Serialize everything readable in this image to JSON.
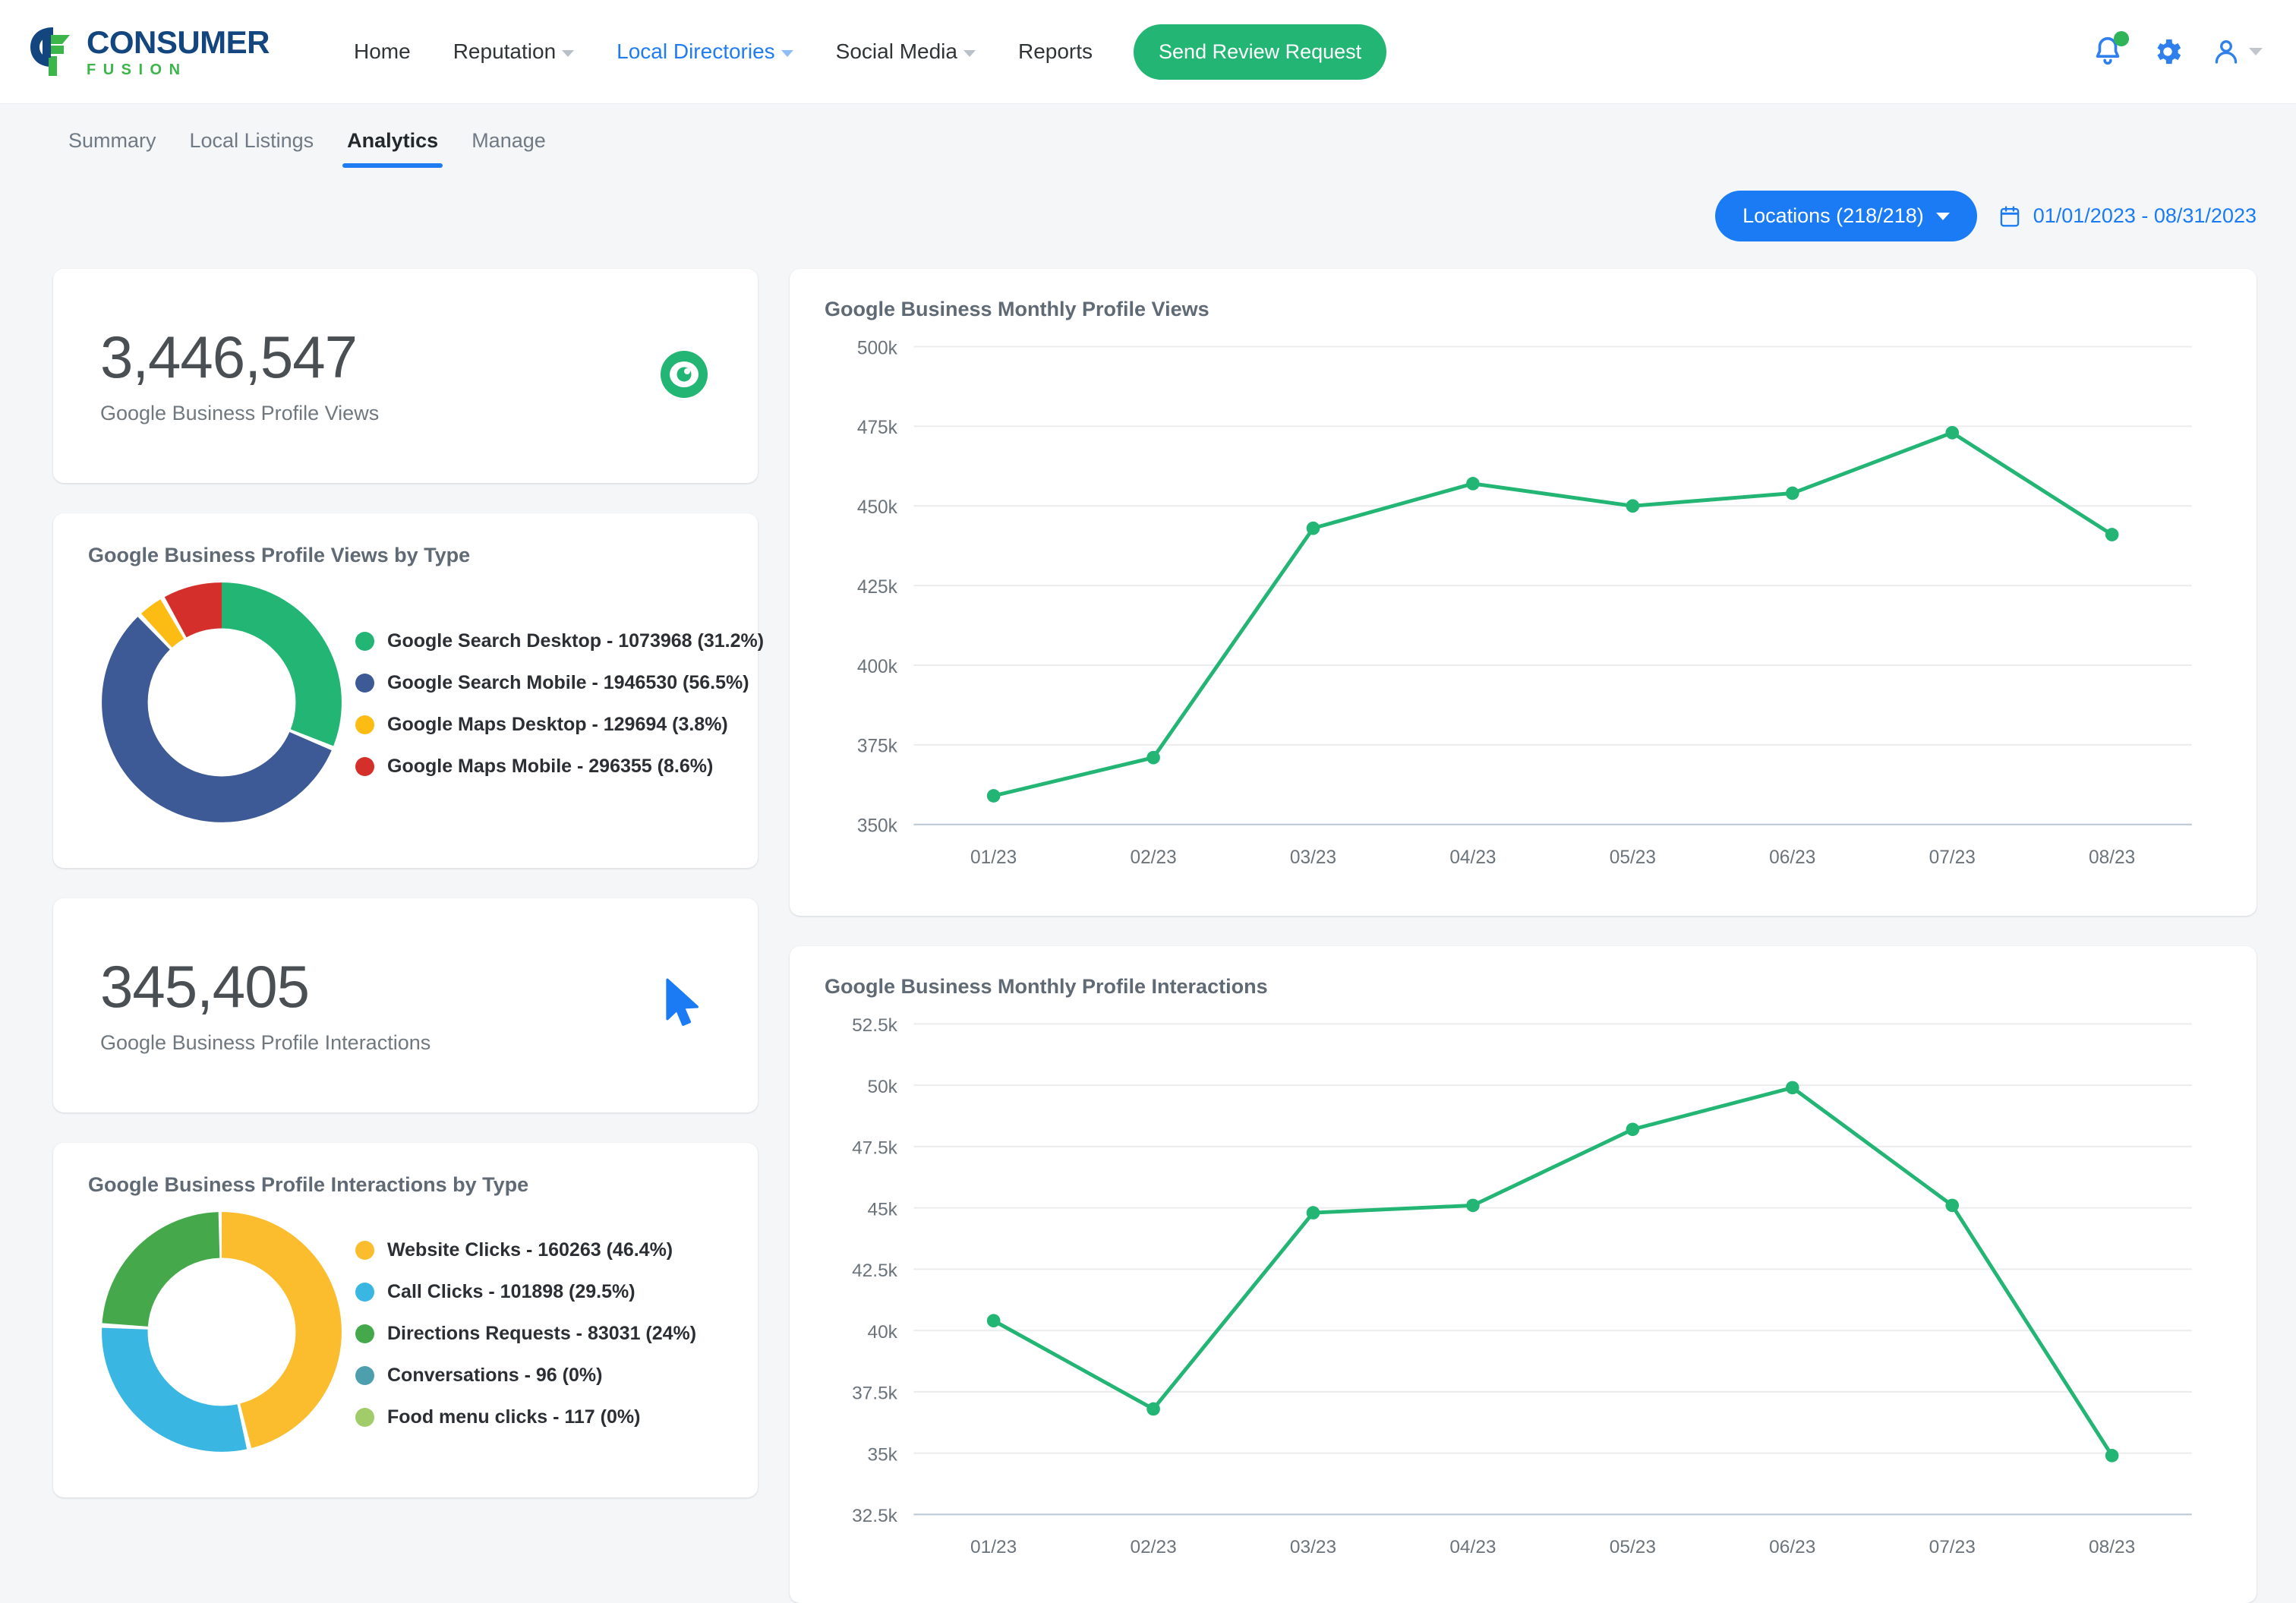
{
  "brand": {
    "name_top": "CONSUMER",
    "name_bottom": "FUSION"
  },
  "nav": {
    "items": [
      {
        "label": "Home",
        "has_caret": false,
        "active": false
      },
      {
        "label": "Reputation",
        "has_caret": true,
        "active": false
      },
      {
        "label": "Local Directories",
        "has_caret": true,
        "active": true
      },
      {
        "label": "Social Media",
        "has_caret": true,
        "active": false
      },
      {
        "label": "Reports",
        "has_caret": false,
        "active": false
      }
    ],
    "cta_label": "Send Review Request",
    "icons": [
      "notification-bell-icon",
      "gear-icon",
      "user-avatar-icon"
    ]
  },
  "subtabs": [
    {
      "label": "Summary",
      "active": false
    },
    {
      "label": "Local Listings",
      "active": false
    },
    {
      "label": "Analytics",
      "active": true
    },
    {
      "label": "Manage",
      "active": false
    }
  ],
  "filters": {
    "locations_label": "Locations (218/218)",
    "date_range": "01/01/2023 - 08/31/2023"
  },
  "kpis": [
    {
      "value": "3,446,547",
      "label": "Google Business Profile Views",
      "icon": "eye-icon"
    },
    {
      "value": "345,405",
      "label": "Google Business Profile Interactions",
      "icon": "cursor-icon"
    }
  ],
  "views_by_type": {
    "title": "Google Business Profile Views by Type",
    "legend": [
      {
        "label": "Google Search Desktop - 1073968 (31.2%)",
        "color": "#22b573"
      },
      {
        "label": "Google Search Mobile - 1946530 (56.5%)",
        "color": "#3d5a96"
      },
      {
        "label": "Google Maps Desktop - 129694 (3.8%)",
        "color": "#fdbc14"
      },
      {
        "label": "Google Maps Mobile - 296355 (8.6%)",
        "color": "#d42f2a"
      }
    ]
  },
  "interactions_by_type": {
    "title": "Google Business Profile Interactions by Type",
    "legend": [
      {
        "label": "Website Clicks - 160263 (46.4%)",
        "color": "#fbbc2e"
      },
      {
        "label": "Call Clicks - 101898 (29.5%)",
        "color": "#3ab6e3"
      },
      {
        "label": "Directions Requests - 83031 (24%)",
        "color": "#45a94c"
      },
      {
        "label": "Conversations - 96 (0%)",
        "color": "#4e9fae"
      },
      {
        "label": "Food menu clicks - 117 (0%)",
        "color": "#a2cc6a"
      }
    ]
  },
  "chart_data": [
    {
      "type": "pie",
      "title": "Google Business Profile Views by Type",
      "subtype": "donut",
      "labels": [
        "Google Search Desktop",
        "Google Search Mobile",
        "Google Maps Desktop",
        "Google Maps Mobile"
      ],
      "values": [
        1073968,
        1946530,
        129694,
        296355
      ],
      "percents": [
        31.2,
        56.5,
        3.8,
        8.6
      ],
      "colors": [
        "#22b573",
        "#3d5a96",
        "#fdbc14",
        "#d42f2a"
      ],
      "total": 3446547,
      "legend_position": "right"
    },
    {
      "type": "pie",
      "title": "Google Business Profile Interactions by Type",
      "subtype": "donut",
      "labels": [
        "Website Clicks",
        "Call Clicks",
        "Directions Requests",
        "Conversations",
        "Food menu clicks"
      ],
      "values": [
        160263,
        101898,
        83031,
        96,
        117
      ],
      "percents": [
        46.4,
        29.5,
        24.0,
        0.0,
        0.0
      ],
      "colors": [
        "#fbbc2e",
        "#3ab6e3",
        "#45a94c",
        "#4e9fae",
        "#a2cc6a"
      ],
      "total": 345405,
      "legend_position": "right"
    },
    {
      "type": "line",
      "title": "Google Business Monthly Profile Views",
      "x": [
        "01/23",
        "02/23",
        "03/23",
        "04/23",
        "05/23",
        "06/23",
        "07/23",
        "08/23"
      ],
      "series": [
        {
          "name": "Profile Views",
          "values": [
            359000,
            371000,
            443000,
            457000,
            450000,
            454000,
            473000,
            441000
          ],
          "color": "#22b573"
        }
      ],
      "xlabel": "",
      "ylabel": "",
      "ylim": [
        350000,
        500000
      ],
      "ytick_labels": [
        "500k",
        "475k",
        "450k",
        "425k",
        "400k",
        "375k",
        "350k"
      ],
      "ytick_values": [
        500000,
        475000,
        450000,
        425000,
        400000,
        375000,
        350000
      ],
      "grid": true,
      "legend_position": "none"
    },
    {
      "type": "line",
      "title": "Google Business Monthly Profile Interactions",
      "x": [
        "01/23",
        "02/23",
        "03/23",
        "04/23",
        "05/23",
        "06/23",
        "07/23",
        "08/23"
      ],
      "series": [
        {
          "name": "Profile Interactions",
          "values": [
            40400,
            36800,
            44800,
            45100,
            48200,
            49900,
            45100,
            34900
          ],
          "color": "#22b573"
        }
      ],
      "xlabel": "",
      "ylabel": "",
      "ylim": [
        32500,
        52500
      ],
      "ytick_labels": [
        "52.5k",
        "50k",
        "47.5k",
        "45k",
        "42.5k",
        "40k",
        "37.5k",
        "35k",
        "32.5k"
      ],
      "ytick_values": [
        52500,
        50000,
        47500,
        45000,
        42500,
        40000,
        37500,
        35000,
        32500
      ],
      "grid": true,
      "legend_position": "none"
    }
  ]
}
